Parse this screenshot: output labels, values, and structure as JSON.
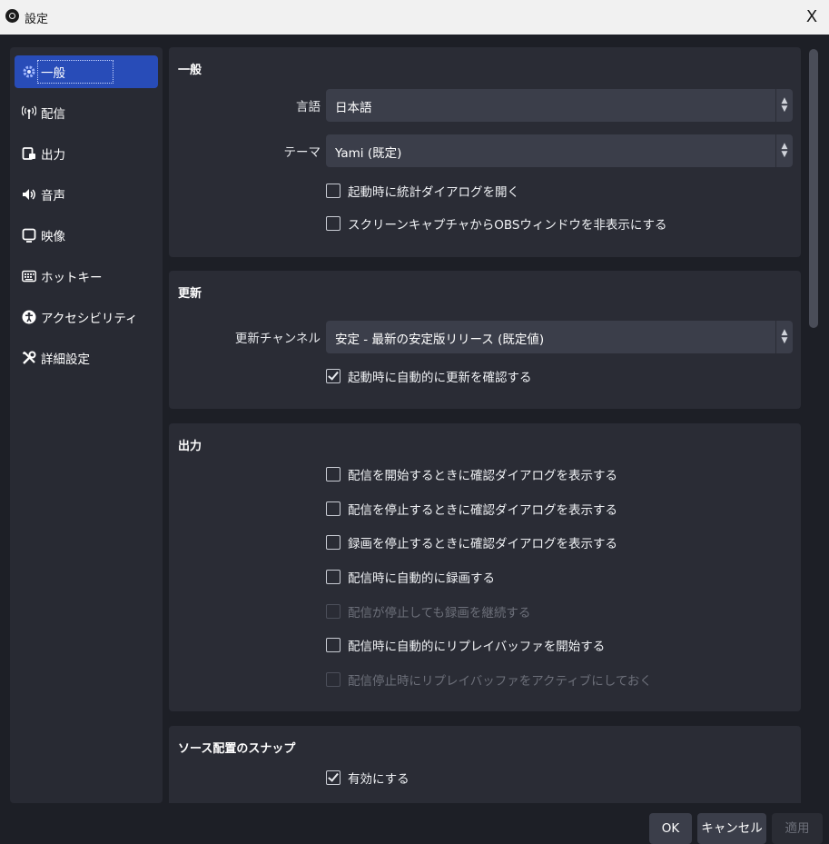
{
  "window": {
    "title": "設定",
    "close_glyph": "X"
  },
  "sidebar": {
    "items": [
      {
        "label": "一般",
        "icon": "gear-icon",
        "active": true
      },
      {
        "label": "配信",
        "icon": "antenna-icon"
      },
      {
        "label": "出力",
        "icon": "output-icon"
      },
      {
        "label": "音声",
        "icon": "speaker-icon"
      },
      {
        "label": "映像",
        "icon": "monitor-icon"
      },
      {
        "label": "ホットキー",
        "icon": "keyboard-icon"
      },
      {
        "label": "アクセシビリティ",
        "icon": "accessibility-icon"
      },
      {
        "label": "詳細設定",
        "icon": "tools-icon"
      }
    ]
  },
  "general": {
    "title": "一般",
    "language_label": "言語",
    "language_value": "日本語",
    "theme_label": "テーマ",
    "theme_value": "Yami (既定)",
    "open_stats_on_startup": {
      "label": "起動時に統計ダイアログを開く",
      "checked": false
    },
    "hide_obs_from_capture": {
      "label": "スクリーンキャプチャからOBSウィンドウを非表示にする",
      "checked": false
    }
  },
  "update": {
    "title": "更新",
    "channel_label": "更新チャンネル",
    "channel_value": "安定 - 最新の安定版リリース (既定値)",
    "auto_check": {
      "label": "起動時に自動的に更新を確認する",
      "checked": true
    }
  },
  "output": {
    "title": "出力",
    "options": [
      {
        "label": "配信を開始するときに確認ダイアログを表示する",
        "checked": false,
        "enabled": true
      },
      {
        "label": "配信を停止するときに確認ダイアログを表示する",
        "checked": false,
        "enabled": true
      },
      {
        "label": "録画を停止するときに確認ダイアログを表示する",
        "checked": false,
        "enabled": true
      },
      {
        "label": "配信時に自動的に録画する",
        "checked": false,
        "enabled": true
      },
      {
        "label": "配信が停止しても録画を継続する",
        "checked": false,
        "enabled": false
      },
      {
        "label": "配信時に自動的にリプレイバッファを開始する",
        "checked": false,
        "enabled": true
      },
      {
        "label": "配信停止時にリプレイバッファをアクティブにしておく",
        "checked": false,
        "enabled": false
      }
    ]
  },
  "snapping": {
    "title": "ソース配置のスナップ",
    "enable": {
      "label": "有効にする",
      "checked": true
    }
  },
  "buttons": {
    "ok": "OK",
    "cancel": "キャンセル",
    "apply": "適用"
  },
  "colors": {
    "accent": "#284cb8",
    "background": "#1d1f26",
    "panel": "#2a2c35",
    "input": "#3b3e4a"
  }
}
